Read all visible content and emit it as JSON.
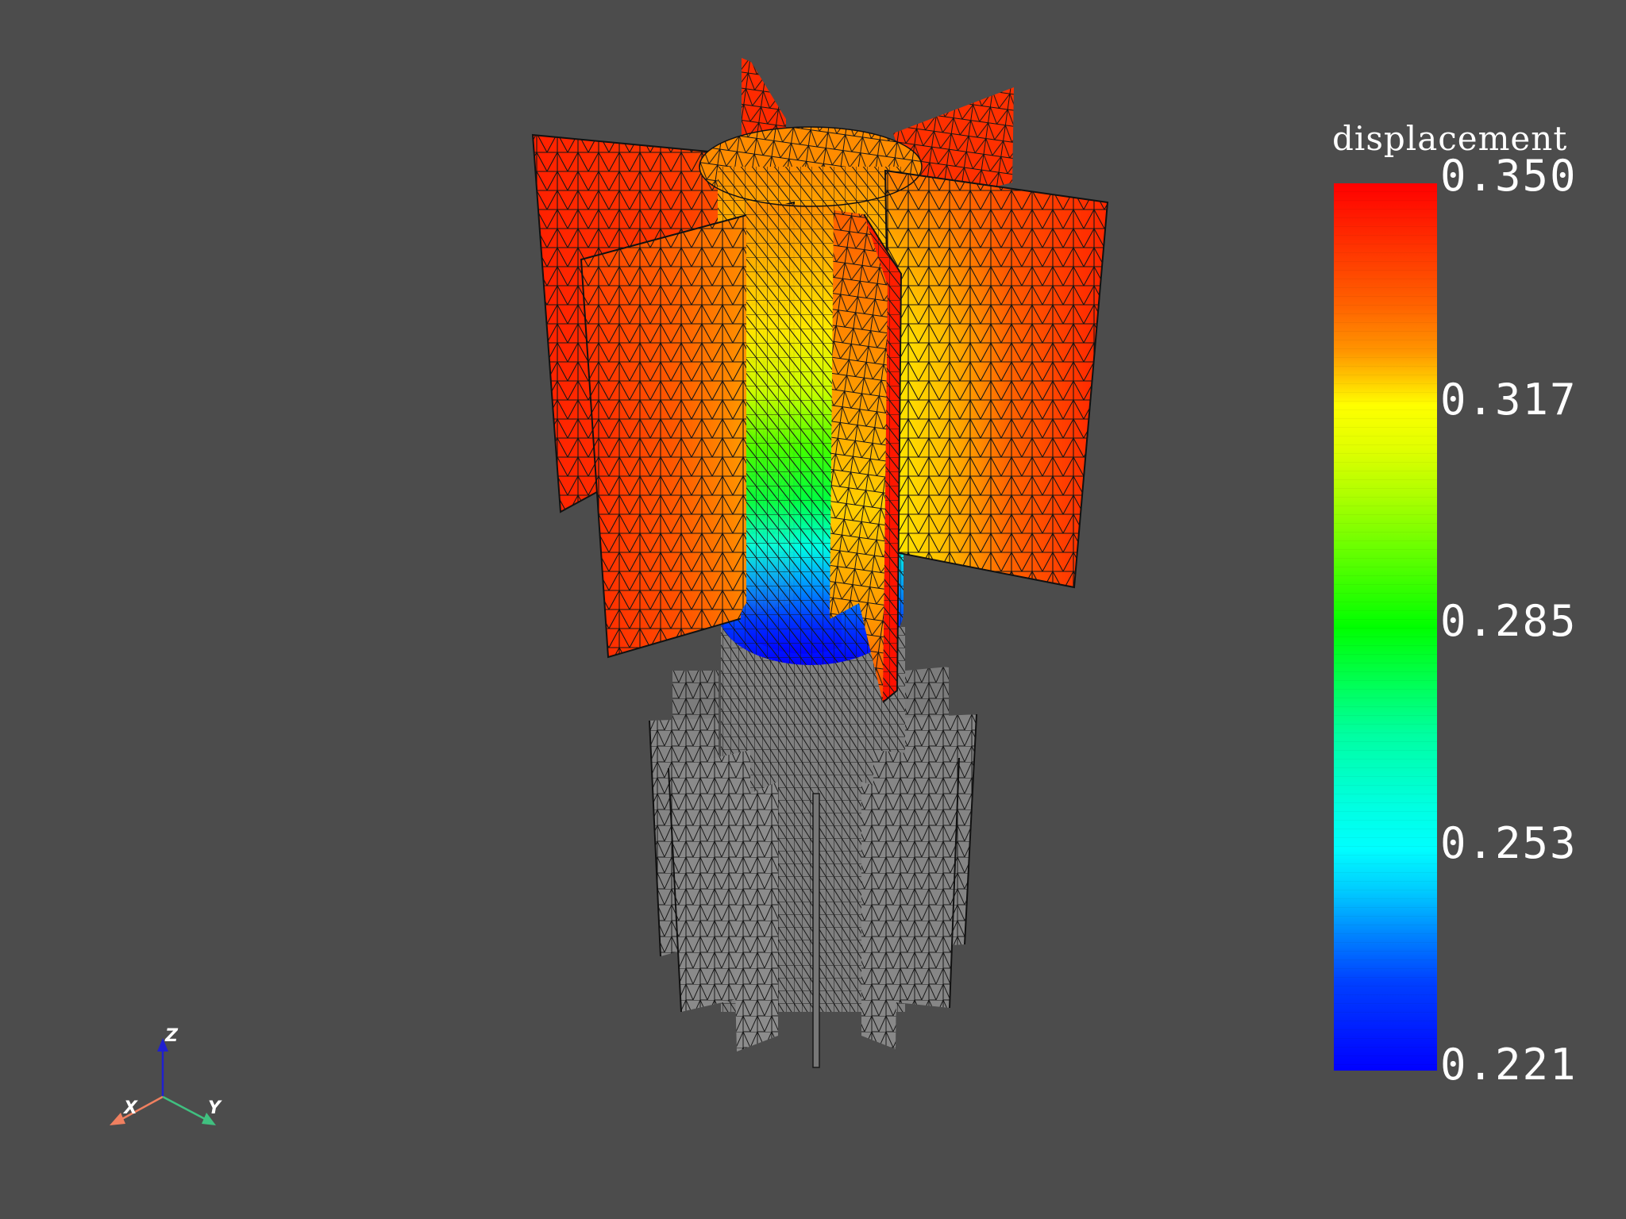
{
  "colorbar": {
    "title": "displacement",
    "ticks": [
      "0.350",
      "0.317",
      "0.285",
      "0.253",
      "0.221"
    ],
    "min": 0.221,
    "max": 0.35,
    "colormap": "jet"
  },
  "axes_widget": {
    "x_label": "X",
    "y_label": "Y",
    "z_label": "Z",
    "x_color": "#f08060",
    "y_color": "#40c080",
    "z_color": "#2020d0"
  },
  "colors": {
    "background": "#4c4c4c",
    "mesh_unscalared": "#808080",
    "mesh_edges": "#1a1a1a"
  }
}
